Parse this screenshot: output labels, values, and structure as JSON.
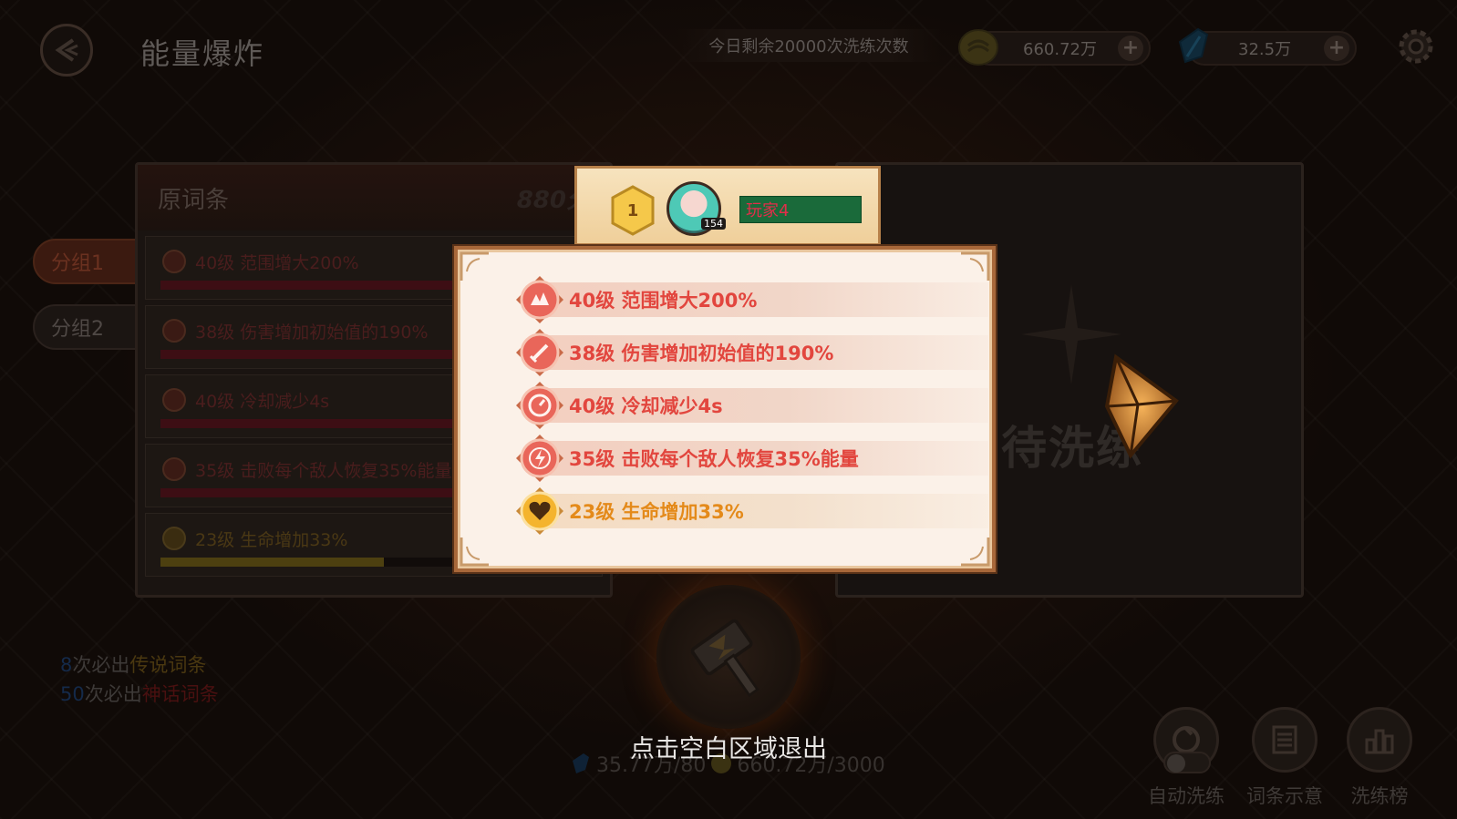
{
  "header": {
    "title": "能量爆炸",
    "remaining_text": "今日剩余20000次洗练次数",
    "currencies": [
      {
        "icon": "coin-icon",
        "value": "660.72万"
      },
      {
        "icon": "gem-icon",
        "value": "32.5万"
      }
    ]
  },
  "tabs": [
    {
      "label": "分组1",
      "active": true
    },
    {
      "label": "分组2",
      "active": false
    }
  ],
  "original_panel": {
    "title": "原词条",
    "score": "880分",
    "affixes": [
      {
        "text": "40级 范围增大200%",
        "fill": 1.0,
        "rarity": "red"
      },
      {
        "text": "38级 伤害增加初始值的190%",
        "fill": 1.0,
        "rarity": "red"
      },
      {
        "text": "40级 冷却减少4s",
        "fill": 1.0,
        "rarity": "red"
      },
      {
        "text": "35级 击败每个敌人恢复35%能量",
        "fill": 1.0,
        "rarity": "red"
      },
      {
        "text": "23级 生命增加33%",
        "fill": 0.57,
        "rarity": "gold"
      }
    ]
  },
  "pending_panel": {
    "text": "待洗练"
  },
  "guarantees": [
    {
      "count": "8",
      "prefix": "次必出",
      "tier": "传说词条"
    },
    {
      "count": "50",
      "prefix": "次必出",
      "tier": "神话词条"
    }
  ],
  "cost": {
    "gem": "35.77万/80",
    "coin": "660.72万/3000"
  },
  "exit_hint": "点击空白区域退出",
  "bottom_buttons": [
    {
      "label": "自动洗练",
      "icon": "auto-refine-icon"
    },
    {
      "label": "词条示意",
      "icon": "affix-list-icon"
    },
    {
      "label": "洗练榜",
      "icon": "leaderboard-icon"
    }
  ],
  "popup": {
    "rank": "1",
    "avatar_level": "154",
    "player_name": "玩家4",
    "affixes": [
      {
        "text": "40级 范围增大200%",
        "icon": "range-icon",
        "rarity": "red"
      },
      {
        "text": "38级 伤害增加初始值的190%",
        "icon": "sword-icon",
        "rarity": "red"
      },
      {
        "text": "40级 冷却减少4s",
        "icon": "clock-icon",
        "rarity": "red"
      },
      {
        "text": "35级 击败每个敌人恢复35%能量",
        "icon": "energy-icon",
        "rarity": "red"
      },
      {
        "text": "23级 生命增加33%",
        "icon": "heart-icon",
        "rarity": "gold"
      }
    ]
  },
  "colors": {
    "red_affix": "#e2463e",
    "gold_affix": "#e48a1a",
    "popup_bg": "#fbf1e8",
    "name_bg": "#1a6a3a"
  }
}
